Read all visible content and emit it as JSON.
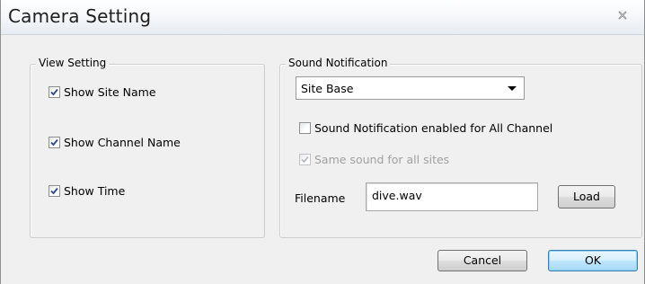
{
  "window": {
    "title": "Camera Setting"
  },
  "view_setting": {
    "legend": "View Setting",
    "options": [
      {
        "label": "Show Site Name",
        "checked": true
      },
      {
        "label": "Show Channel Name",
        "checked": true
      },
      {
        "label": "Show Time",
        "checked": true
      }
    ]
  },
  "sound_notification": {
    "legend": "Sound Notification",
    "mode_selected": "Site Base",
    "enable_all_label": "Sound Notification enabled for All Channel",
    "enable_all_checked": false,
    "same_sound_label": "Same sound for all sites",
    "same_sound_checked": true,
    "same_sound_disabled": true,
    "filename_label": "Filename",
    "filename_value": "dive.wav",
    "load_label": "Load"
  },
  "footer": {
    "cancel_label": "Cancel",
    "ok_label": "OK"
  },
  "icons": {
    "close": "close-icon",
    "check": "checkmark-icon",
    "dropdown": "chevron-down-icon"
  },
  "colors": {
    "window_bg": "#f0f0f0",
    "check_mark": "#2a4a8a",
    "disabled_text": "#a0a0a0",
    "default_button_border": "#3c7fb1"
  }
}
